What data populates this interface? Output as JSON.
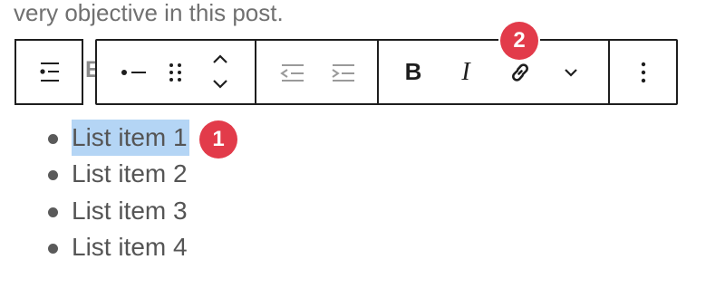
{
  "intro_text": "very objective in this post.",
  "toolbar": {
    "list_type_icon": "unordered-list-icon",
    "peek_letter": "E",
    "item_icon": "bullet-item-icon",
    "drag_icon": "drag-handle-icon",
    "move_up_icon": "chevron-up-icon",
    "move_down_icon": "chevron-down-icon",
    "outdent_icon": "outdent-icon",
    "indent_icon": "indent-icon",
    "bold_label": "B",
    "italic_label": "I",
    "link_icon": "link-icon",
    "more_formats_icon": "chevron-down-icon",
    "options_icon": "kebab-menu-icon"
  },
  "list": {
    "items": [
      "List item 1",
      "List item 2",
      "List item 3",
      "List item 4"
    ],
    "selected_index": 0
  },
  "callouts": {
    "first": "1",
    "second": "2"
  },
  "colors": {
    "selection": "#b4d5f5",
    "badge": "#e23b4a",
    "border": "#1e1e1e",
    "text": "#555555"
  }
}
